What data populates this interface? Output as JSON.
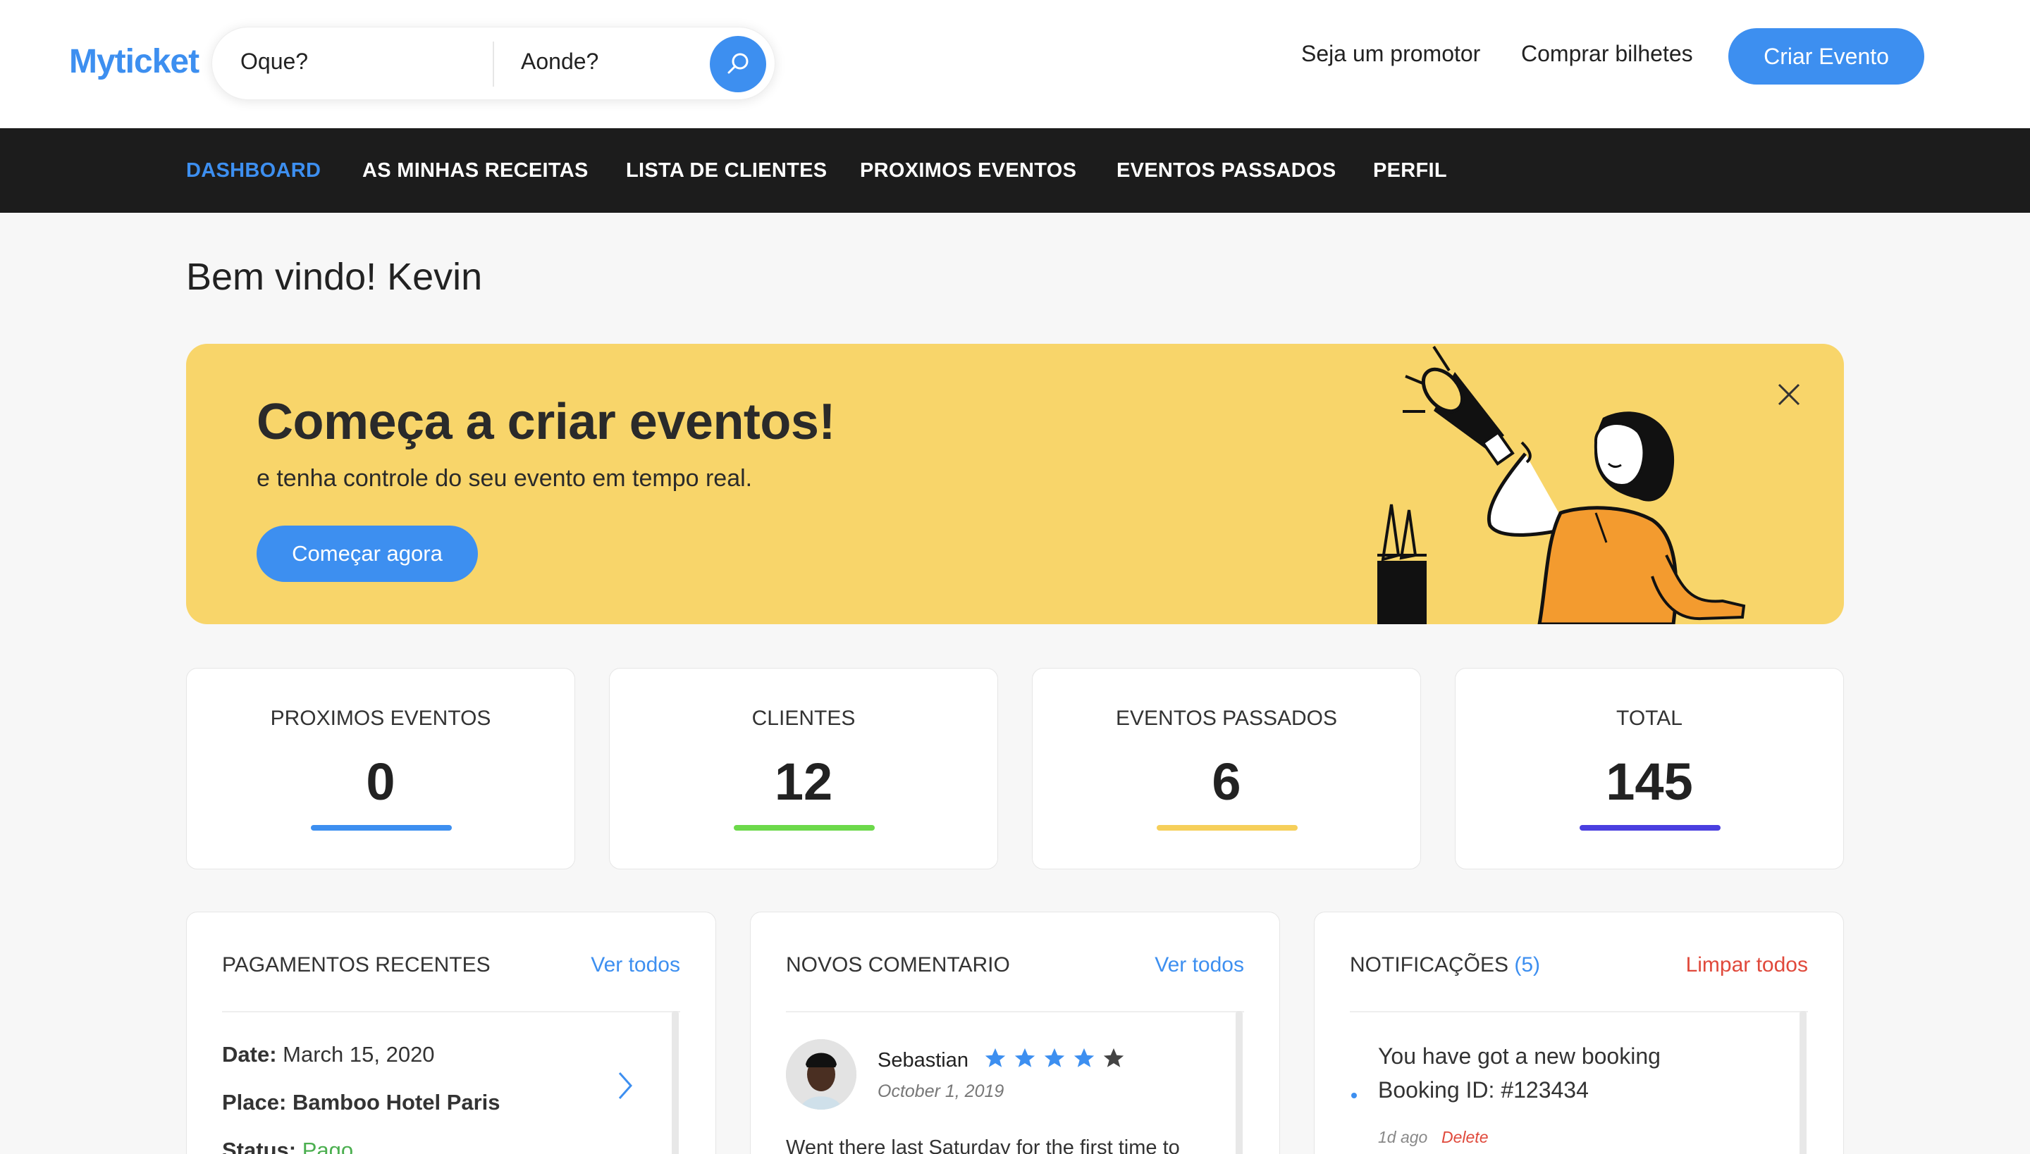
{
  "header": {
    "logo": "Myticket",
    "search": {
      "what_placeholder": "Oque?",
      "where_placeholder": "Aonde?"
    },
    "links": {
      "promoter": "Seja um promotor",
      "buy": "Comprar bilhetes"
    },
    "cta": "Criar Evento"
  },
  "nav": {
    "items": [
      "DASHBOARD",
      "AS MINHAS RECEITAS",
      "LISTA DE CLIENTES",
      "PROXIMOS EVENTOS",
      "EVENTOS PASSADOS",
      "PERFIL"
    ],
    "active": "DASHBOARD"
  },
  "welcome": "Bem vindo! Kevin",
  "banner": {
    "title": "Começa a criar eventos!",
    "subtitle": "e tenha controle do seu evento em tempo real.",
    "button": "Começar agora"
  },
  "stats": [
    {
      "label": "PROXIMOS EVENTOS",
      "value": "0",
      "color": "#3d8ff0"
    },
    {
      "label": "CLIENTES",
      "value": "12",
      "color": "#6cd94a"
    },
    {
      "label": "EVENTOS PASSADOS",
      "value": "6",
      "color": "#f6cf5a"
    },
    {
      "label": "TOTAL",
      "value": "145",
      "color": "#4a3fe0"
    }
  ],
  "payments": {
    "title": "PAGAMENTOS RECENTES",
    "link": "Ver todos",
    "date_label": "Date:",
    "date": "March 15, 2020",
    "place_label": "Place:",
    "place": "Bamboo Hotel Paris",
    "status_label": "Status:",
    "status": "Pago",
    "status_color": "#4caf50"
  },
  "comments": {
    "title": "NOVOS COMENTARIO",
    "link": "Ver todos",
    "name": "Sebastian",
    "rating": 4,
    "max_rating": 5,
    "date": "October 1, 2019",
    "text": "Went there last Saturday for the first time to"
  },
  "notifications": {
    "title": "NOTIFICAÇÕES",
    "count": "(5)",
    "link": "Limpar todos",
    "line1": "You have got a new booking",
    "line2": "Booking ID: #123434",
    "ago": "1d ago",
    "delete": "Delete"
  },
  "colors": {
    "accent": "#3d8ff0",
    "banner": "#f8d56a",
    "nav_bg": "#1c1c1c",
    "danger": "#e0493b"
  }
}
